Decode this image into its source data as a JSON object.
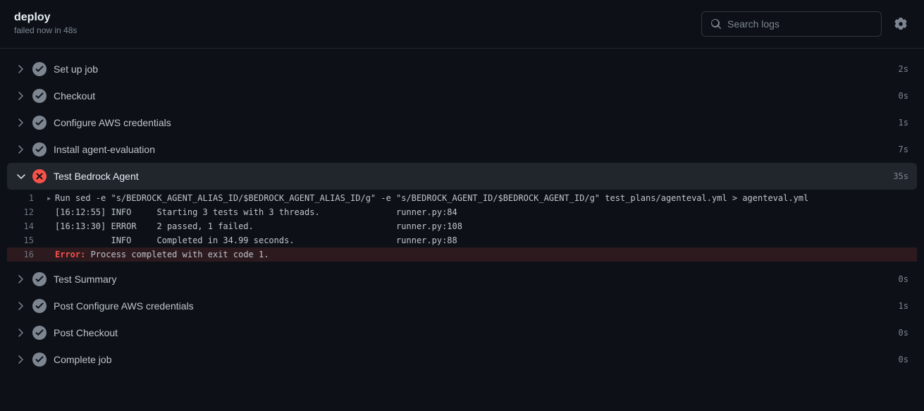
{
  "header": {
    "title": "deploy",
    "subtitle": "failed now in 48s"
  },
  "search": {
    "placeholder": "Search logs",
    "value": ""
  },
  "steps": [
    {
      "name": "Set up job",
      "time": "2s",
      "status": "success",
      "expanded": false
    },
    {
      "name": "Checkout",
      "time": "0s",
      "status": "success",
      "expanded": false
    },
    {
      "name": "Configure AWS credentials",
      "time": "1s",
      "status": "success",
      "expanded": false
    },
    {
      "name": "Install agent-evaluation",
      "time": "7s",
      "status": "success",
      "expanded": false
    },
    {
      "name": "Test Bedrock Agent",
      "time": "35s",
      "status": "failure",
      "expanded": true
    },
    {
      "name": "Test Summary",
      "time": "0s",
      "status": "success",
      "expanded": false
    },
    {
      "name": "Post Configure AWS credentials",
      "time": "1s",
      "status": "success",
      "expanded": false
    },
    {
      "name": "Post Checkout",
      "time": "0s",
      "status": "success",
      "expanded": false
    },
    {
      "name": "Complete job",
      "time": "0s",
      "status": "success",
      "expanded": false
    }
  ],
  "logs": [
    {
      "n": "1",
      "tri": true,
      "text": "Run sed -e \"s/BEDROCK_AGENT_ALIAS_ID/$BEDROCK_AGENT_ALIAS_ID/g\" -e \"s/BEDROCK_AGENT_ID/$BEDROCK_AGENT_ID/g\" test_plans/agenteval.yml > agenteval.yml"
    },
    {
      "n": "12",
      "tri": false,
      "text": "[16:12:55] INFO     Starting 3 tests with 3 threads.               runner.py:84"
    },
    {
      "n": "14",
      "tri": false,
      "text": "[16:13:30] ERROR    2 passed, 1 failed.                            runner.py:108"
    },
    {
      "n": "15",
      "tri": false,
      "text": "           INFO     Completed in 34.99 seconds.                    runner.py:88"
    },
    {
      "n": "16",
      "tri": false,
      "error": true,
      "err_label": "Error:",
      "err_msg": " Process completed with exit code 1."
    }
  ]
}
